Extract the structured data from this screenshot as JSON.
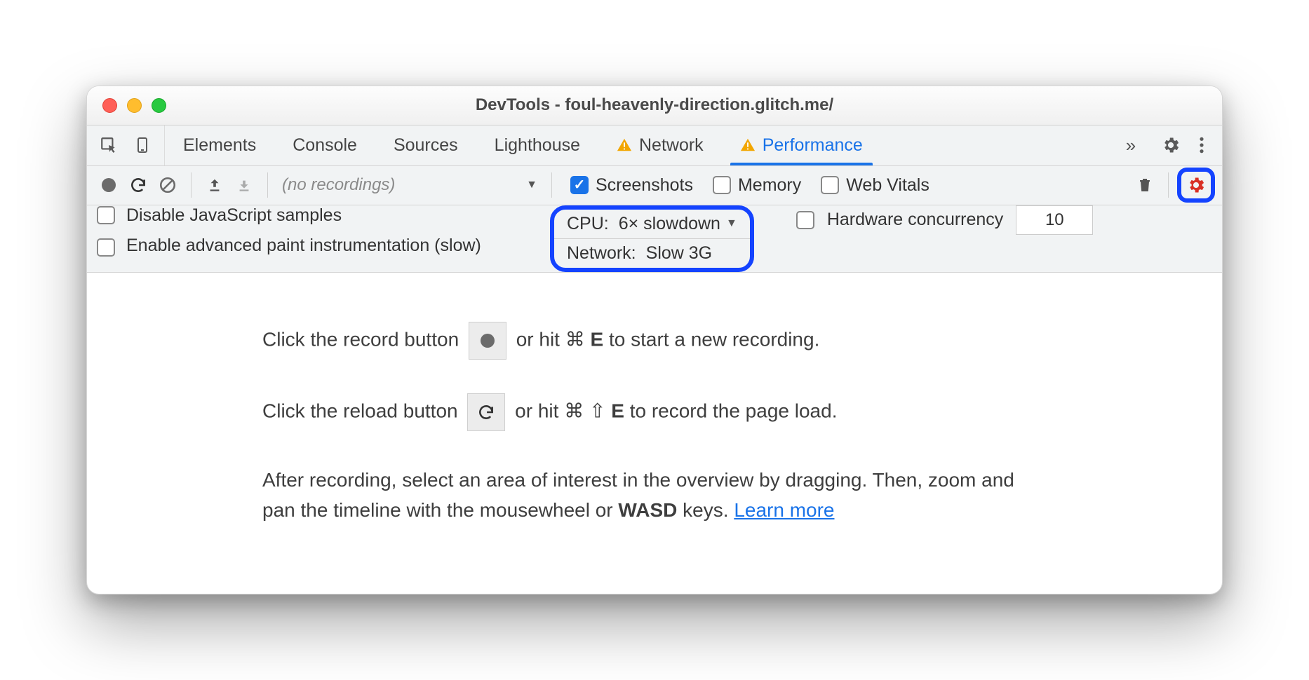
{
  "window": {
    "title": "DevTools - foul-heavenly-direction.glitch.me/"
  },
  "tabs": {
    "items": [
      "Elements",
      "Console",
      "Sources",
      "Lighthouse",
      "Network",
      "Performance"
    ],
    "active": "Performance",
    "warn_on": [
      "Network",
      "Performance"
    ]
  },
  "toolbar": {
    "recordings_label": "(no recordings)",
    "screenshots": {
      "label": "Screenshots",
      "checked": true
    },
    "memory": {
      "label": "Memory",
      "checked": false
    },
    "webvitals": {
      "label": "Web Vitals",
      "checked": false
    }
  },
  "settings": {
    "disable_js": {
      "label": "Disable JavaScript samples",
      "checked": false
    },
    "advanced_paint": {
      "label": "Enable advanced paint instrumentation (slow)",
      "checked": false
    },
    "cpu": {
      "label": "CPU:",
      "value": "6× slowdown"
    },
    "network": {
      "label": "Network:",
      "value": "Slow 3G"
    },
    "hw_concurrency": {
      "label": "Hardware concurrency",
      "checked": false,
      "value": "10"
    }
  },
  "instructions": {
    "l1a": "Click the record button ",
    "l1b": " or hit ",
    "l1_cmd": "⌘",
    "l1_e": "E",
    "l1c": " to start a new recording.",
    "l2a": "Click the reload button ",
    "l2b": " or hit ",
    "l2_cmd": "⌘",
    "l2_shift": "⇧",
    "l2_e": "E",
    "l2c": " to record the page load.",
    "l3a": "After recording, select an area of interest in the overview by dragging. Then, zoom and pan the timeline with the mousewheel or ",
    "l3_wasd": "WASD",
    "l3b": " keys. ",
    "learn_more": "Learn more"
  }
}
